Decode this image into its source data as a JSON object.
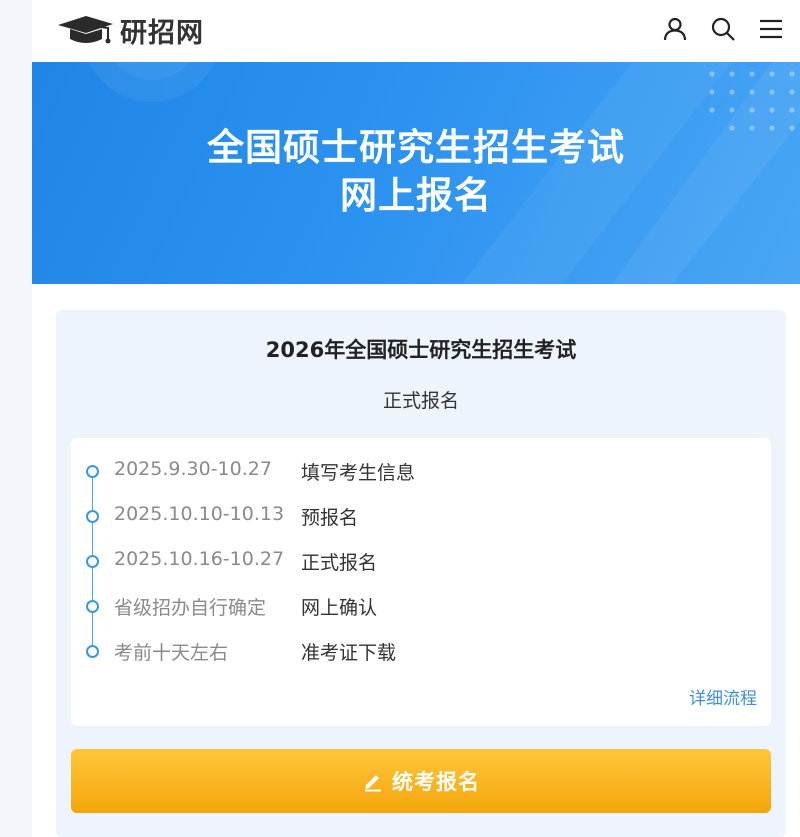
{
  "header": {
    "logo_text": "研招网",
    "icons": [
      "user-icon",
      "search-icon",
      "menu-icon"
    ]
  },
  "banner": {
    "title_line1": "全国硕士研究生招生考试",
    "title_line2": "网上报名"
  },
  "card": {
    "title": "2026年全国硕士研究生招生考试",
    "subtitle": "正式报名",
    "timeline": [
      {
        "date": "2025.9.30-10.27",
        "label": "填写考生信息"
      },
      {
        "date": "2025.10.10-10.13",
        "label": "预报名"
      },
      {
        "date": "2025.10.16-10.27",
        "label": "正式报名"
      },
      {
        "date": "省级招办自行确定",
        "label": "网上确认"
      },
      {
        "date": "考前十天左右",
        "label": "准考证下载"
      }
    ],
    "detail_link": "详细流程",
    "register_button": "统考报名"
  },
  "colors": {
    "banner_blue": "#2b92f0",
    "accent_blue": "#3d97dd",
    "button_orange": "#f4a60c"
  }
}
